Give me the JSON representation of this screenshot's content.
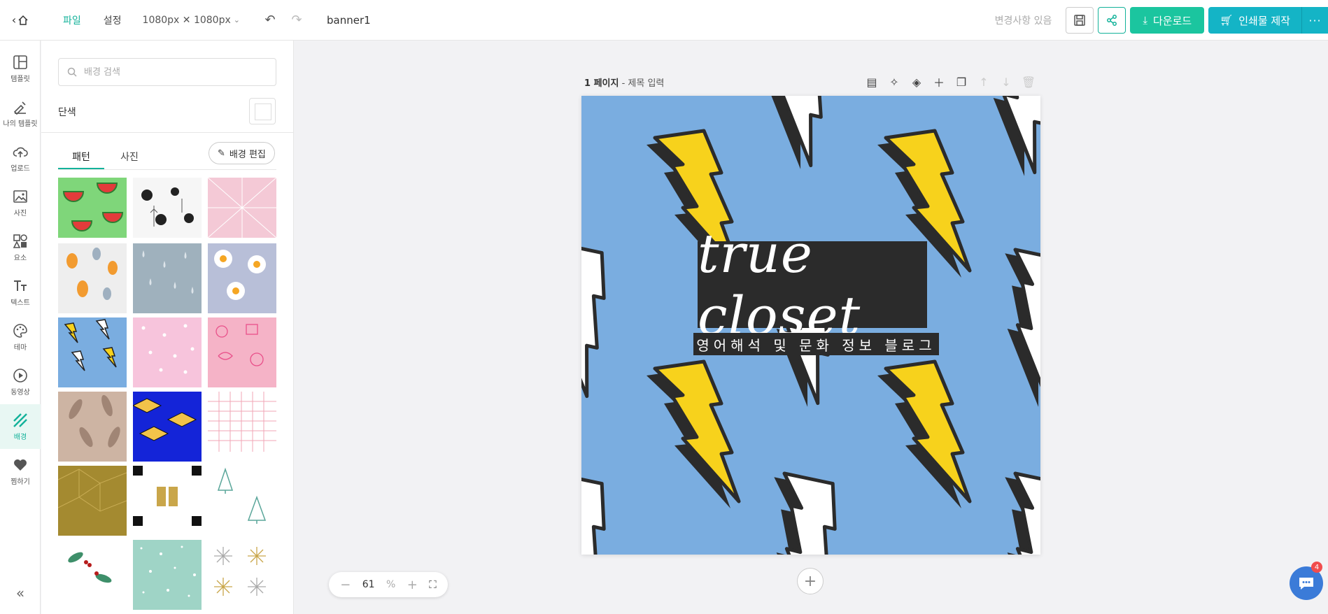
{
  "topbar": {
    "menu_file": "파일",
    "menu_settings": "설정",
    "canvas_size": "1080px ✕ 1080px",
    "doc_name": "banner1",
    "changes_status": "변경사항 있음",
    "download_label": "다운로드",
    "print_label": "인쇄물 제작",
    "more_label": "···"
  },
  "rail": {
    "items": [
      {
        "label": "템플릿",
        "icon": "template-icon"
      },
      {
        "label": "나의 템플릿",
        "icon": "my-template-icon"
      },
      {
        "label": "업로드",
        "icon": "upload-cloud-icon"
      },
      {
        "label": "사진",
        "icon": "photo-icon"
      },
      {
        "label": "요소",
        "icon": "elements-icon"
      },
      {
        "label": "텍스트",
        "icon": "text-icon"
      },
      {
        "label": "테마",
        "icon": "palette-icon"
      },
      {
        "label": "동영상",
        "icon": "play-circle-icon"
      },
      {
        "label": "배경",
        "icon": "background-icon"
      },
      {
        "label": "찜하기",
        "icon": "heart-icon"
      }
    ],
    "active_index": 8,
    "collapse_label": "«"
  },
  "panel": {
    "search_placeholder": "배경 검색",
    "solid_label": "단색",
    "tabs": [
      {
        "label": "패턴"
      },
      {
        "label": "사진"
      }
    ],
    "active_tab": 0,
    "edit_label": "배경 편집",
    "patterns": [
      {
        "name": "watermelon",
        "bg": "#7fd67a"
      },
      {
        "name": "plants-black-white",
        "bg": "#f6f6f6"
      },
      {
        "name": "pink-geometric",
        "bg": "#f4c9d6"
      },
      {
        "name": "autumn-trees",
        "bg": "#eeeeee"
      },
      {
        "name": "rain-drops",
        "bg": "#9fb1bd"
      },
      {
        "name": "fried-eggs",
        "bg": "#b8bfd8"
      },
      {
        "name": "lightning-blue",
        "bg": "#7aade0"
      },
      {
        "name": "pink-dots",
        "bg": "#f7c4dc"
      },
      {
        "name": "pink-doodles",
        "bg": "#f5b3c7"
      },
      {
        "name": "feathers",
        "bg": "#cdb4a3"
      },
      {
        "name": "blue-yellow-cubes",
        "bg": "#1424d8"
      },
      {
        "name": "pink-grid",
        "bg": "#ffffff"
      },
      {
        "name": "gold-polygon",
        "bg": "#a48a30"
      },
      {
        "name": "gift-boxes",
        "bg": "#ffffff"
      },
      {
        "name": "xmas-trees",
        "bg": "#ffffff"
      },
      {
        "name": "holly-leaves",
        "bg": "#ffffff"
      },
      {
        "name": "mint-snow",
        "bg": "#9fd4c6"
      },
      {
        "name": "snowflakes",
        "bg": "#ffffff"
      }
    ]
  },
  "canvas": {
    "page_number": "1 페이지",
    "page_title_placeholder": "제목 입력",
    "title_text": "true closet",
    "subtitle_text": "영어해석 및 문화 정보 블로그",
    "background_color": "#7aade0"
  },
  "zoom": {
    "value": "61",
    "unit": "%"
  },
  "chat": {
    "badge_count": "4"
  },
  "colors": {
    "accent": "#13b29a",
    "download": "#1bc59f",
    "print": "#14b4c6",
    "bolt_yellow": "#f7d21c",
    "bolt_dark": "#2b2b2b"
  }
}
